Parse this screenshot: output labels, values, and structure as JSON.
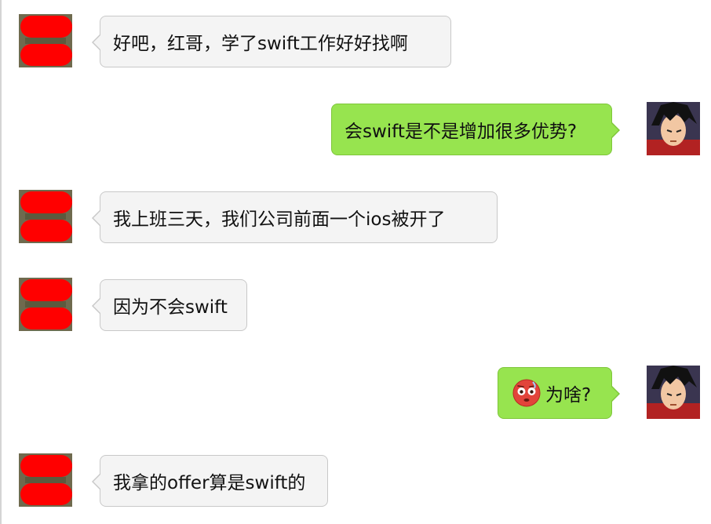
{
  "colors": {
    "incoming_bubble": "#f4f4f4",
    "outgoing_bubble": "#97e44f",
    "redaction": "#ff0000"
  },
  "messages": [
    {
      "side": "incoming",
      "text": "好吧，红哥，学了swift工作好好找啊"
    },
    {
      "side": "outgoing",
      "text": "会swift是不是增加很多优势?"
    },
    {
      "side": "incoming",
      "text": "我上班三天，我们公司前面一个ios被开了"
    },
    {
      "side": "incoming",
      "text": "因为不会swift"
    },
    {
      "side": "outgoing",
      "emoji": "flushed-face-emoji",
      "text": "为啥?"
    },
    {
      "side": "incoming",
      "text": "我拿的offer算是swift的"
    }
  ]
}
